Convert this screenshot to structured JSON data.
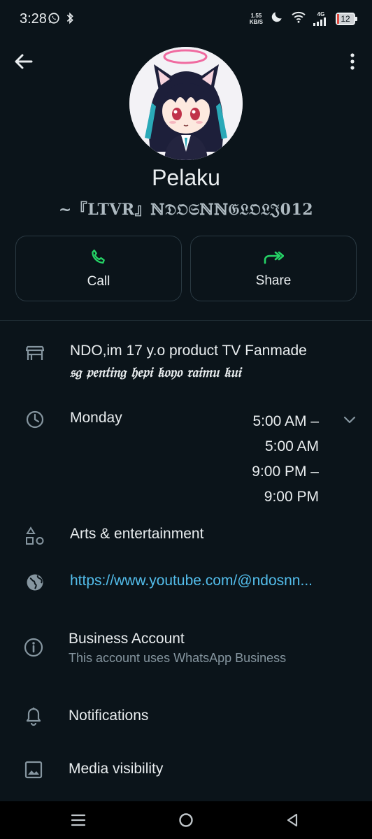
{
  "status_bar": {
    "time": "3:28",
    "net_speed_value": "1.55",
    "net_speed_unit": "KB/S",
    "network_type": "4G",
    "battery_level": "12"
  },
  "profile": {
    "name": "Pelaku",
    "about": "~『LTVR』ℕ𝔇𝔒𝔖ℕℕ𝔊𝔏𝔒𝔏𝔍012"
  },
  "actions": [
    {
      "label": "Call",
      "icon": "phone-icon"
    },
    {
      "label": "Share",
      "icon": "share-forward-icon"
    }
  ],
  "business": {
    "description_line1": "NDO,im 17 y.o product TV Fanmade",
    "description_line2": "𝔰𝔤 𝔭𝔢𝔫𝔱𝔦𝔫𝔤 𝔥𝔢𝔭𝔦 𝔨𝔬𝔶𝔬 𝔯𝔞𝔦𝔪𝔲 𝔨𝔲𝔦",
    "hours_day": "Monday",
    "hours_line1": "5:00 AM –",
    "hours_line2": "5:00 AM",
    "hours_line3": "9:00 PM –",
    "hours_line4": "9:00 PM",
    "category": "Arts & entertainment",
    "website": "https://www.youtube.com/@ndosnn..."
  },
  "settings": {
    "business_account_title": "Business Account",
    "business_account_subtitle": "This account uses WhatsApp Business",
    "notifications": "Notifications",
    "media_visibility": "Media visibility"
  },
  "colors": {
    "background": "#0b141a",
    "accent_green": "#25d366",
    "link_blue": "#53bdeb",
    "secondary_text": "#8696a0"
  }
}
